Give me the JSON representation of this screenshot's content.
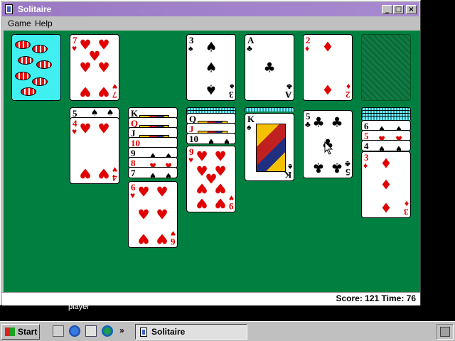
{
  "window": {
    "title": "Solitaire",
    "controls": {
      "minimize": "_",
      "maximize": "□",
      "close": "×"
    }
  },
  "menu": {
    "items": [
      "Game",
      "Help"
    ]
  },
  "status": {
    "text": "Score: 121 Time: 76"
  },
  "desktop": {
    "label": "player"
  },
  "taskbar": {
    "start_label": "Start",
    "more": "»",
    "task_label": "Solitaire"
  },
  "foundations": [
    {
      "rank": "3",
      "suit": "♠",
      "color": "black"
    },
    {
      "rank": "A",
      "suit": "♣",
      "color": "black"
    },
    {
      "rank": "2",
      "suit": "♦",
      "color": "red"
    }
  ],
  "waste": {
    "rank": "7",
    "suit": "♥",
    "color": "red"
  },
  "tableau": {
    "col1_stub": {
      "rank": "5",
      "suit": "♠"
    },
    "col1_top": {
      "rank": "4",
      "suit": "♥"
    },
    "col2_stubs": [
      {
        "rank": "K",
        "suit": "♠"
      },
      {
        "rank": "Q",
        "suit": "♥"
      },
      {
        "rank": "J",
        "suit": "♠"
      },
      {
        "rank": "10",
        "suit": "♥"
      },
      {
        "rank": "9",
        "suit": "♠"
      },
      {
        "rank": "8",
        "suit": "♥"
      },
      {
        "rank": "7",
        "suit": "♠"
      }
    ],
    "col2_top": {
      "rank": "6",
      "suit": "♥"
    },
    "col3_stubs": [
      {
        "rank": "Q",
        "suit": "♠"
      },
      {
        "rank": "J",
        "suit": "♥"
      },
      {
        "rank": "10",
        "suit": "♠"
      }
    ],
    "col3_top": {
      "rank": "9",
      "suit": "♥"
    },
    "col4_top": {
      "rank": "K",
      "suit": "♠"
    },
    "col5_top": {
      "rank": "5",
      "suit": "♣"
    },
    "col6_stubs": [
      {
        "rank": "6",
        "suit": "♠"
      },
      {
        "rank": "5",
        "suit": "♥"
      },
      {
        "rank": "4",
        "suit": "♠"
      }
    ],
    "col6_top": {
      "rank": "3",
      "suit": "♦"
    }
  }
}
